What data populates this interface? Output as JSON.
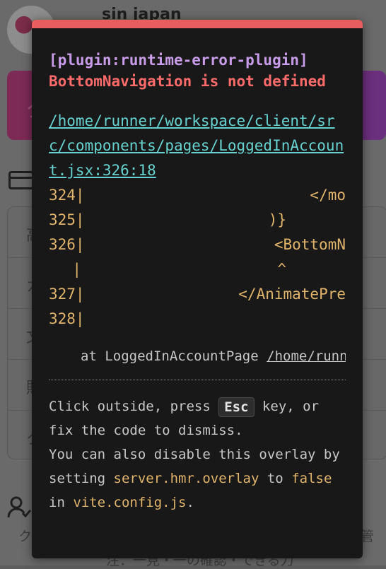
{
  "background": {
    "username": "sin japan",
    "banner_text": "ク",
    "list_rows": [
      "高",
      "カ",
      "文",
      "賄",
      "ク"
    ],
    "footer_left": "ク",
    "footer_right": "管",
    "footer_center": "注：一見・一の確認・できる刀",
    "colors": {
      "banner_start": "#7d2a55",
      "banner_end": "#6a2f7e"
    }
  },
  "overlay": {
    "plugin": "[plugin:runtime-error-plugin]",
    "message": "BottomNavigation is not defined",
    "file_link": "/home/runner/workspace/client/src/components/pages/LoggedInAccount.jsx:326:18",
    "frame": [
      {
        "num": "324|",
        "code": "</mo"
      },
      {
        "num": "325|",
        "code": ")}"
      },
      {
        "num": "326|",
        "code": "<BottomN"
      },
      {
        "num": "|",
        "code": "^"
      },
      {
        "num": "327|",
        "code": "</AnimatePre"
      },
      {
        "num": "328|",
        "code": ""
      }
    ],
    "stack_prefix": "at LoggedInAccountPage",
    "stack_path": "/home/runn",
    "tip": {
      "t1": "Click outside, press ",
      "key": "Esc",
      "t2": " key, or fix the code to dismiss.",
      "t3": "You can also disable this overlay by setting ",
      "option": "server.hmr.overlay",
      "t4": " to ",
      "value": "false",
      "t5": " in ",
      "config": "vite.config.js",
      "t6": "."
    },
    "colors": {
      "accent_bar": "#e85d5d",
      "plugin": "#c99ce9",
      "error": "#ff6b6b",
      "link": "#67d2d0",
      "code": "#e1b46b"
    }
  }
}
